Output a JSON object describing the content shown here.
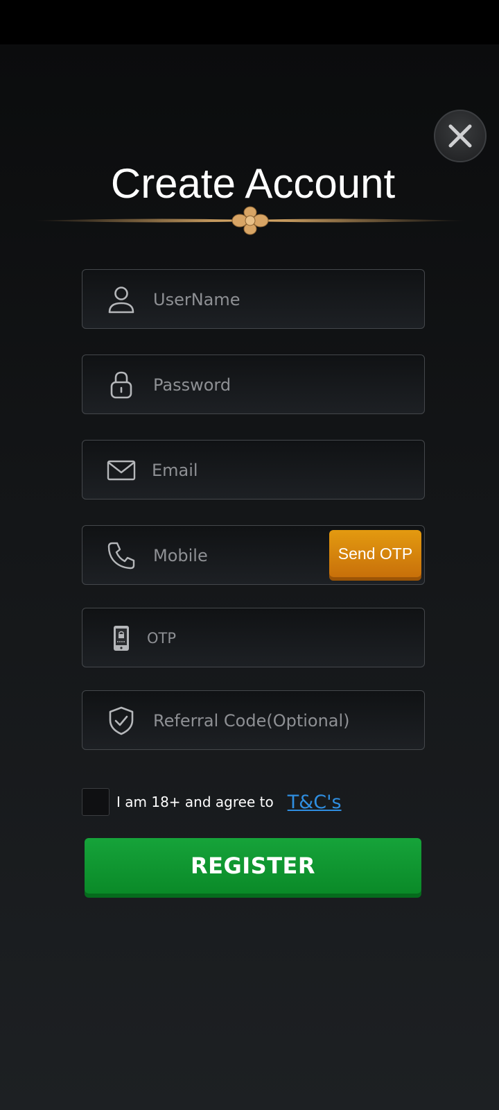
{
  "title": "Create Account",
  "fields": {
    "username": {
      "placeholder": "UserName",
      "icon": "user-icon"
    },
    "password": {
      "placeholder": "Password",
      "icon": "lock-icon"
    },
    "email": {
      "placeholder": "Email",
      "icon": "mail-icon"
    },
    "mobile": {
      "placeholder": "Mobile",
      "icon": "phone-icon",
      "action_label": "Send OTP"
    },
    "otp": {
      "placeholder": "OTP",
      "icon": "smartphone-lock-icon"
    },
    "referral": {
      "placeholder": "Referral Code(Optional)",
      "icon": "shield-check-icon"
    }
  },
  "agree": {
    "text": "I am 18+ and agree to",
    "link_label": "T&C's"
  },
  "register_label": "REGISTER",
  "colors": {
    "accent_orange": "#d9870c",
    "register_green": "#0f9a30",
    "link_blue": "#2f8ee0",
    "divider_gold": "#c99a5b"
  }
}
